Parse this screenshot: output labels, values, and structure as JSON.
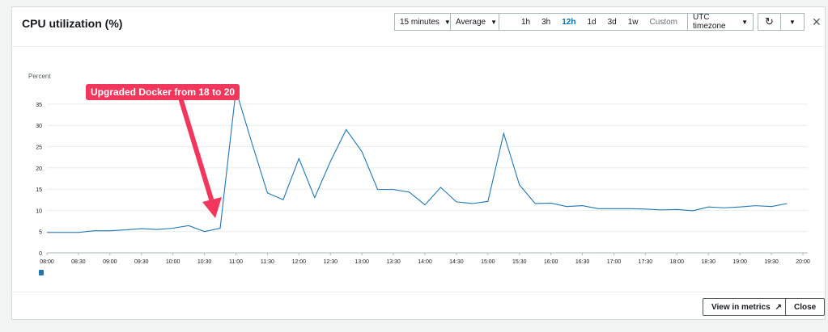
{
  "header": {
    "title": "CPU utilization (%)",
    "period": "15 minutes",
    "statistic": "Average",
    "ranges": [
      "1h",
      "3h",
      "12h",
      "1d",
      "3d",
      "1w"
    ],
    "selected_range": "12h",
    "custom": "Custom",
    "timezone": "UTC timezone"
  },
  "annotation": "Upgraded Docker from 18 to 20",
  "footer": {
    "view_in_metrics": "View in metrics",
    "close": "Close"
  },
  "colors": {
    "line": "#1f77b4",
    "annotation": "#f2375d",
    "accent": "#0073bb"
  },
  "chart_data": {
    "type": "line",
    "ylabel": "Percent",
    "ylim": [
      0,
      38
    ],
    "yticks": [
      0,
      5,
      10,
      15,
      20,
      25,
      30,
      35
    ],
    "xticks": [
      "08:00",
      "08:30",
      "09:00",
      "09:30",
      "10:00",
      "10:30",
      "11:00",
      "11:30",
      "12:00",
      "12:30",
      "13:00",
      "13:30",
      "14:00",
      "14:30",
      "15:00",
      "15:30",
      "16:00",
      "16:30",
      "17:00",
      "17:30",
      "18:00",
      "18:30",
      "19:00",
      "19:30",
      "20:00"
    ],
    "x_start_minutes": 480,
    "x_end_minutes": 1200,
    "step_minutes": 15,
    "series": [
      {
        "name": "CPU utilization",
        "values": [
          4.8,
          4.8,
          4.8,
          5.2,
          5.2,
          5.4,
          5.7,
          5.5,
          5.8,
          6.4,
          5.0,
          5.8,
          38.3,
          26,
          14.1,
          12.5,
          22.2,
          13,
          21.5,
          29,
          23.8,
          14.9,
          14.9,
          14.3,
          11.3,
          15.4,
          12,
          11.6,
          12.1,
          28.1,
          16,
          11.6,
          11.7,
          10.9,
          11.1,
          10.4,
          10.4,
          10.4,
          10.3,
          10.1,
          10.2,
          9.9,
          10.8,
          10.6,
          10.8,
          11.1,
          10.9,
          11.6
        ]
      }
    ]
  }
}
